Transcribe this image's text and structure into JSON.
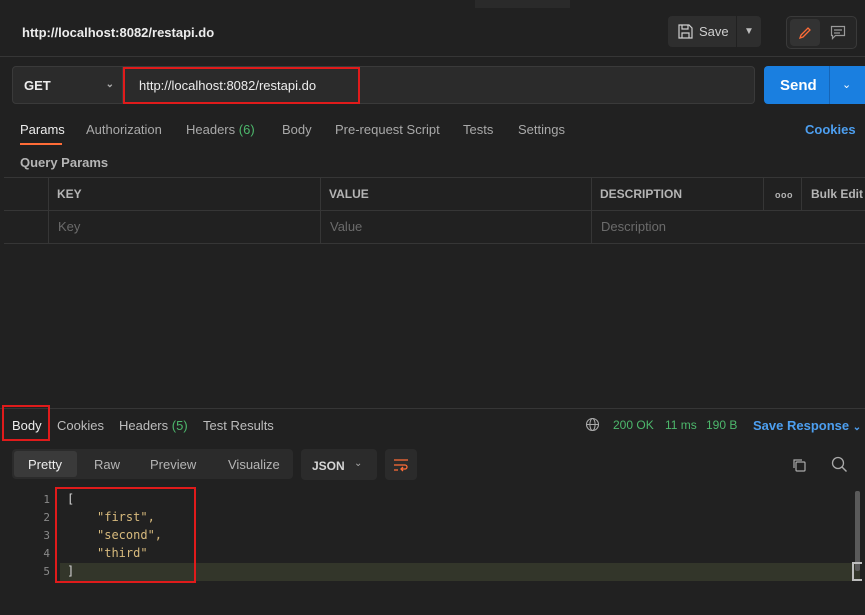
{
  "header": {
    "title": "http://localhost:8082/restapi.do",
    "save_label": "Save"
  },
  "request": {
    "method": "GET",
    "url": "http://localhost:8082/restapi.do",
    "send_label": "Send"
  },
  "request_tabs": {
    "params": "Params",
    "authorization": "Authorization",
    "headers": "Headers",
    "headers_count": "(6)",
    "body": "Body",
    "prerequest": "Pre-request Script",
    "tests": "Tests",
    "settings": "Settings",
    "cookies": "Cookies"
  },
  "query_params": {
    "label": "Query Params",
    "columns": {
      "key": "KEY",
      "value": "VALUE",
      "description": "DESCRIPTION",
      "more": "ooo",
      "bulk_edit": "Bulk Edit"
    },
    "placeholders": {
      "key": "Key",
      "value": "Value",
      "description": "Description"
    }
  },
  "response": {
    "tabs": {
      "body": "Body",
      "cookies": "Cookies",
      "headers": "Headers",
      "headers_count": "(5)",
      "test_results": "Test Results"
    },
    "status": "200 OK",
    "time": "11 ms",
    "size": "190 B",
    "save_response": "Save Response",
    "format_tabs": {
      "pretty": "Pretty",
      "raw": "Raw",
      "preview": "Preview",
      "visualize": "Visualize"
    },
    "format": "JSON",
    "code_lines": [
      {
        "num": "1",
        "text": "["
      },
      {
        "num": "2",
        "text": "\"first\","
      },
      {
        "num": "3",
        "text": "\"second\","
      },
      {
        "num": "4",
        "text": "\"third\""
      },
      {
        "num": "5",
        "text": "]"
      }
    ]
  },
  "colors": {
    "accent_orange": "#ff6c37",
    "send_blue": "#1a7fe0",
    "link_blue": "#4d9ff0",
    "status_green": "#4db86c",
    "highlight_red": "#e01b1b"
  }
}
